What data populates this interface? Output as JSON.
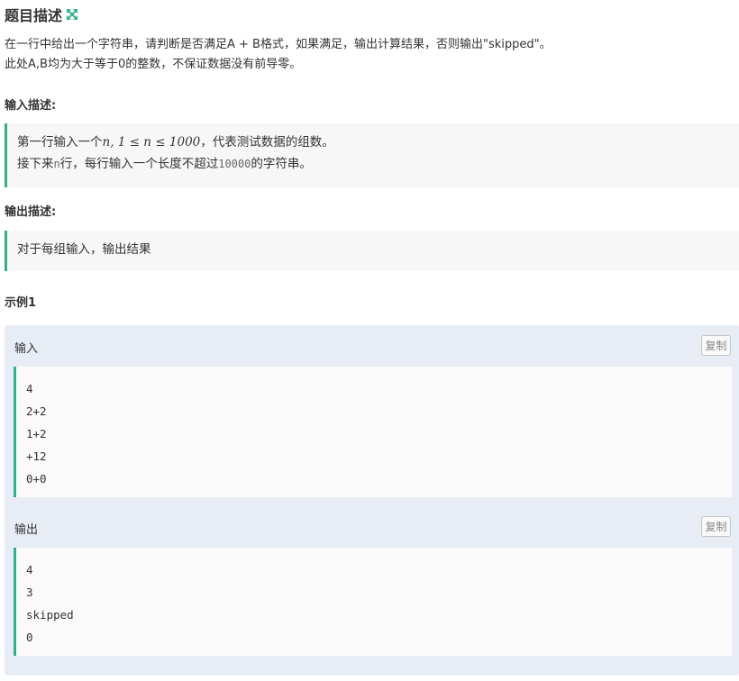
{
  "header": {
    "title": "题目描述",
    "expand_icon": "expand-arrows-icon",
    "accent_color": "#2fb08b"
  },
  "description": {
    "line1": "在一行中给出一个字符串，请判断是否满足A + B格式，如果满足，输出计算结果，否则输出\"skipped\"。",
    "line2": "此处A,B均为大于等于0的整数，不保证数据没有前导零。"
  },
  "input_desc": {
    "label": "输入描述:",
    "line1_prefix": "第一行输入一个",
    "line1_math_n": "n",
    "line1_math_comma": ", ",
    "line1_math_1": "1",
    "line1_math_le1": " ≤ ",
    "line1_math_n2": "n",
    "line1_math_le2": " ≤ ",
    "line1_math_1000": "1000",
    "line1_suffix": "，代表测试数据的组数。",
    "line2_prefix": "接下来",
    "line2_code": "n",
    "line2_mid": "行，每行输入一个长度不超过",
    "line2_code2": "10000",
    "line2_suffix": "的字符串。"
  },
  "output_desc": {
    "label": "输出描述:",
    "text": "对于每组输入，输出结果"
  },
  "example": {
    "label": "示例1",
    "input_label": "输入",
    "output_label": "输出",
    "copy_label": "复制",
    "input_lines": [
      "4",
      "2+2",
      "1+2",
      "+12",
      "0+0"
    ],
    "output_lines": [
      "4",
      "3",
      "skipped",
      "0"
    ]
  }
}
